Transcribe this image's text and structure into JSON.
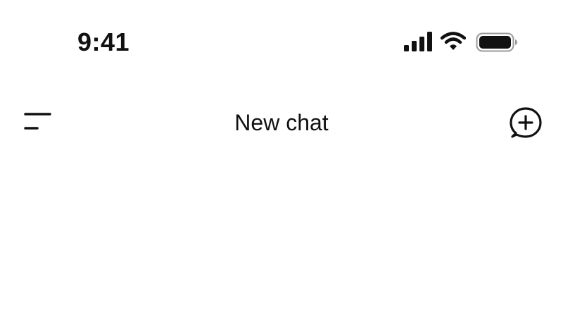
{
  "status_bar": {
    "time": "9:41",
    "icons": [
      "signal-icon",
      "wifi-icon",
      "battery-icon"
    ]
  },
  "nav_bar": {
    "title": "New chat",
    "left_icon": "menu-icon",
    "right_icon": "new-chat-icon"
  },
  "colors": {
    "background": "#ffffff",
    "foreground": "#111111"
  }
}
